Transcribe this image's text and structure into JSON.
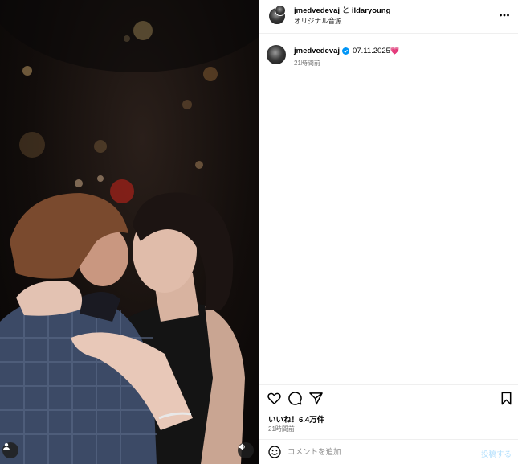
{
  "header": {
    "user1": "jmedvedevaj",
    "connector": "と",
    "user2": "ildaryoung",
    "audio": "オリジナル音源"
  },
  "caption": {
    "username": "jmedvedevaj",
    "text": "07.11.2025",
    "emoji": "💗",
    "time": "21時間前"
  },
  "engagement": {
    "likes": "いいね！6.4万件",
    "time": "21時間前"
  },
  "comment_box": {
    "placeholder": "コメントを追加...",
    "post_label": "投稿する"
  },
  "colors": {
    "verified": "#0095f6",
    "post_button": "#b2dffc",
    "heart": "#e0457b"
  },
  "icons": [
    "more-icon",
    "verified-icon",
    "heart-icon",
    "comment-icon",
    "share-icon",
    "bookmark-icon",
    "emoji-icon",
    "user-tag-icon",
    "sound-icon"
  ]
}
